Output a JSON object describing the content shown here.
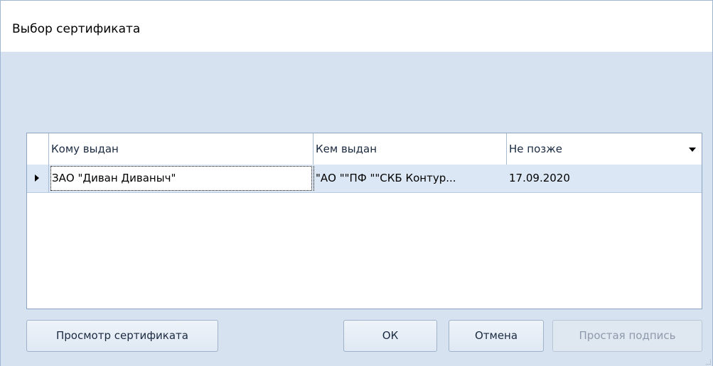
{
  "window": {
    "title": "Выбор сертификата"
  },
  "grid": {
    "columns": [
      "Кому выдан",
      "Кем выдан",
      "Не позже"
    ],
    "rows": [
      {
        "issued_to": "ЗАО \"Диван Диваныч\"",
        "issued_by": "\"АО \"\"ПФ \"\"СКБ Контур...",
        "not_later": "17.09.2020"
      }
    ]
  },
  "buttons": {
    "view_certificate": "Просмотр сертификата",
    "ok": "ОК",
    "cancel": "Отмена",
    "simple_signature": "Простая подпись"
  },
  "icons": {
    "row_indicator": "row-pointer-icon",
    "sort": "sort-desc-icon"
  },
  "colors": {
    "background": "#d6e2f0",
    "selected_row": "#dbe7f5",
    "disabled_text": "#8e9aab"
  }
}
